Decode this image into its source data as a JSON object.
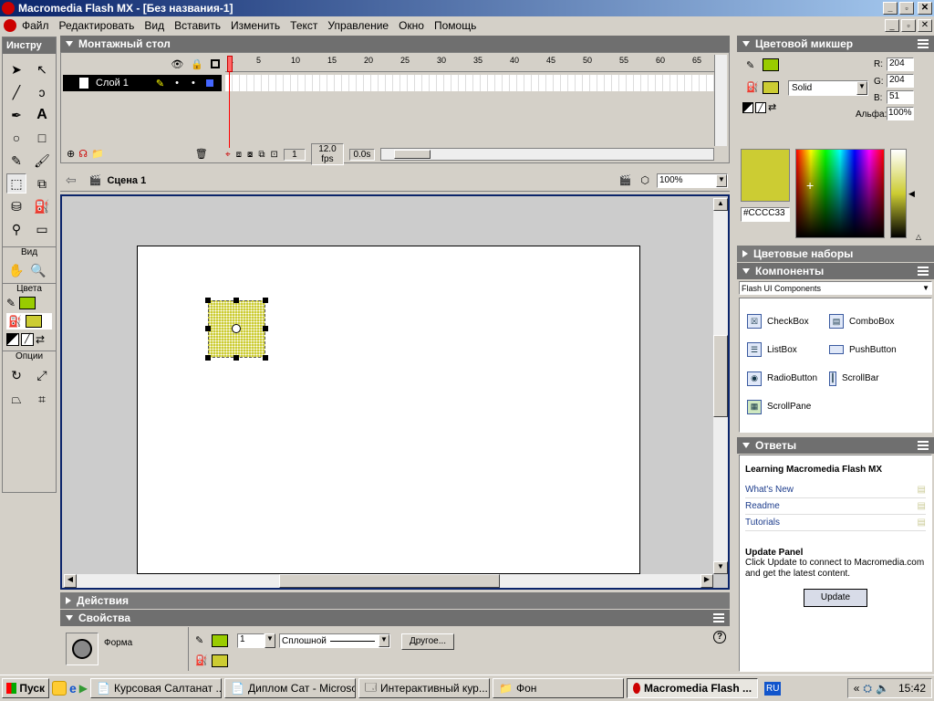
{
  "window": {
    "title": "Macromedia Flash MX - [Без названия-1]"
  },
  "menu": [
    "Файл",
    "Редактировать",
    "Вид",
    "Вставить",
    "Изменить",
    "Текст",
    "Управление",
    "Окно",
    "Помощь"
  ],
  "tools": {
    "title": "Инстру",
    "view_label": "Вид",
    "colors_label": "Цвета",
    "options_label": "Опции"
  },
  "timeline": {
    "title": "Монтажный стол",
    "layer_name": "Слой 1",
    "frame_ticks": [
      "1",
      "5",
      "10",
      "15",
      "20",
      "25",
      "30",
      "35",
      "40",
      "45",
      "50",
      "55",
      "60",
      "65"
    ],
    "current_frame": "1",
    "fps": "12.0 fps",
    "time": "0.0s"
  },
  "scene": {
    "name": "Сцена 1",
    "zoom": "100%"
  },
  "panels": {
    "actions": "Действия",
    "properties": "Свойства",
    "shape_label": "Форма",
    "stroke_width": "1",
    "stroke_style": "Сплошной",
    "other_button": "Другое..."
  },
  "mixer": {
    "title": "Цветовой микшер",
    "fill_type": "Solid",
    "r_label": "R:",
    "r": "204",
    "g_label": "G:",
    "g": "204",
    "b_label": "B:",
    "b": "51",
    "alpha_label": "Альфа:",
    "alpha": "100%",
    "hex": "#CCCC33",
    "color": "#cccc33"
  },
  "swatches": {
    "title": "Цветовые наборы"
  },
  "components": {
    "title": "Компоненты",
    "set": "Flash UI Components",
    "items": [
      "CheckBox",
      "ComboBox",
      "ListBox",
      "PushButton",
      "RadioButton",
      "ScrollBar",
      "ScrollPane"
    ]
  },
  "answers": {
    "title": "Ответы",
    "heading": "Learning Macromedia Flash MX",
    "links": [
      "What's New",
      "Readme",
      "Tutorials"
    ],
    "update_title": "Update Panel",
    "update_text": "Click Update to connect to Macromedia.com and get the latest content.",
    "update_button": "Update"
  },
  "taskbar": {
    "start": "Пуск",
    "tasks": [
      "Курсовая Салтанат ...",
      "Диплом Сат - Microso...",
      "Интерактивный кур...",
      "Фон",
      "Macromedia Flash ..."
    ],
    "lang": "RU",
    "time": "15:42"
  }
}
